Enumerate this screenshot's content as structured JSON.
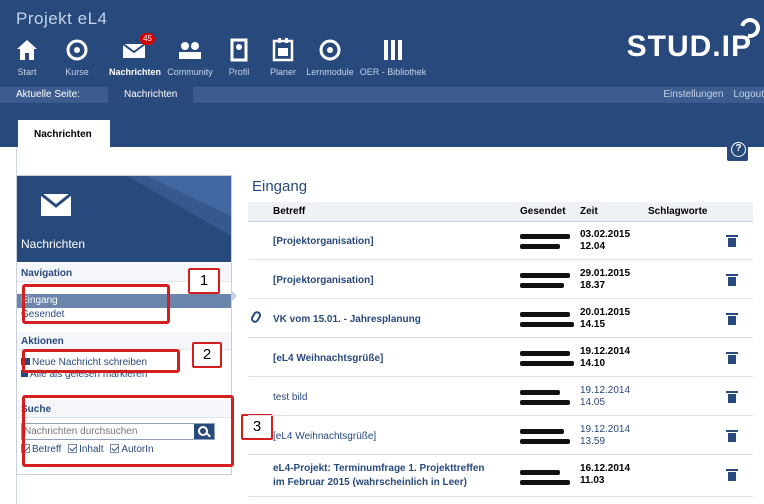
{
  "app_title": "Projekt eL4",
  "nav": [
    {
      "label": "Start",
      "icon": "home-icon"
    },
    {
      "label": "Kurse",
      "icon": "courses-icon"
    },
    {
      "label": "Nachrichten",
      "icon": "mail-icon",
      "badge": "45",
      "active": true
    },
    {
      "label": "Community",
      "icon": "community-icon"
    },
    {
      "label": "Profil",
      "icon": "profile-icon"
    },
    {
      "label": "Planer",
      "icon": "calendar-icon"
    },
    {
      "label": "Lernmodule",
      "icon": "learning-modules-icon"
    },
    {
      "label": "OER - Bibliothek",
      "icon": "library-icon"
    }
  ],
  "logo": "STUD.IP",
  "breadcrumb": {
    "label": "Aktuelle Seite:",
    "current": "Nachrichten"
  },
  "top_links": [
    "Einstellungen",
    "Logout"
  ],
  "tab": "Nachrichten",
  "sidebar": {
    "title": "Nachrichten",
    "navigation_title": "Navigation",
    "navigation": [
      "Eingang",
      "Gesendet"
    ],
    "actions_title": "Aktionen",
    "actions": [
      "Neue Nachricht schreiben",
      "Alle als gelesen markieren"
    ],
    "search_title": "Suche",
    "search_placeholder": "Nachrichten durchsuchen",
    "search_options": [
      "Betreff",
      "Inhalt",
      "AutorIn"
    ]
  },
  "callouts": [
    "1",
    "2",
    "3"
  ],
  "inbox": {
    "title": "Eingang",
    "columns": [
      "Betreff",
      "Gesendet",
      "Zeit",
      "Schlagworte"
    ],
    "rows": [
      {
        "subject": "[Projektorganisation]",
        "date": "03.02.2015",
        "time": "12.04",
        "unread": true,
        "attachment": false
      },
      {
        "subject": "[Projektorganisation]",
        "date": "29.01.2015",
        "time": "18.37",
        "unread": true,
        "attachment": false
      },
      {
        "subject": "VK vom 15.01. - Jahresplanung",
        "date": "20.01.2015",
        "time": "14.15",
        "unread": true,
        "attachment": true
      },
      {
        "subject": "[eL4 Weihnachtsgrüße]",
        "date": "19.12.2014",
        "time": "14.10",
        "unread": true,
        "attachment": false
      },
      {
        "subject": "test bild",
        "date": "19.12.2014",
        "time": "14.05",
        "unread": false,
        "attachment": false
      },
      {
        "subject": "[eL4 Weihnachtsgrüße]",
        "date": "19.12.2014",
        "time": "13.59",
        "unread": false,
        "attachment": false
      },
      {
        "subject_line1": "eL4-Projekt: Terminumfrage 1. Projekttreffen",
        "subject_line2": "im Februar 2015 (wahrscheinlich in Leer)",
        "date": "16.12.2014",
        "time": "11.03",
        "unread": true,
        "attachment": false
      }
    ]
  },
  "colors": {
    "primary": "#28497c",
    "annotation": "#d41f1f"
  }
}
